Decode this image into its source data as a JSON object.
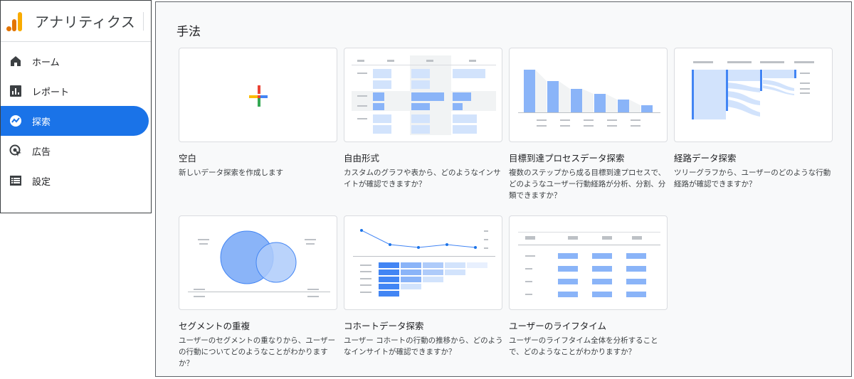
{
  "app": {
    "title": "アナリティクス"
  },
  "sidebar": {
    "items": [
      {
        "label": "ホーム",
        "icon": "home-icon",
        "active": false
      },
      {
        "label": "レポート",
        "icon": "bar-chart-icon",
        "active": false
      },
      {
        "label": "探索",
        "icon": "explore-icon",
        "active": true
      },
      {
        "label": "広告",
        "icon": "ads-cursor-icon",
        "active": false
      },
      {
        "label": "設定",
        "icon": "list-settings-icon",
        "active": false
      }
    ]
  },
  "main": {
    "section_title": "手法",
    "cards": [
      {
        "title": "空白",
        "description": "新しいデータ探索を作成します",
        "thumb": "plus-icon"
      },
      {
        "title": "自由形式",
        "description": "カスタムのグラフや表から、どのようなインサイトが確認できますか？",
        "thumb": "table-thumbnail"
      },
      {
        "title": "目標到達プロセスデータ探索",
        "description": "複数のステップから成る目標到達プロセスで、どのようなユーザー行動経路が分析、分割、分類できますか？",
        "thumb": "funnel-thumbnail"
      },
      {
        "title": "経路データ探索",
        "description": "ツリーグラフから、ユーザーのどのような行動経路が確認できますか？",
        "thumb": "path-thumbnail"
      },
      {
        "title": "セグメントの重複",
        "description": "ユーザーのセグメントの重なりから、ユーザーの行動についてどのようなことがわかりますか？",
        "thumb": "venn-thumbnail"
      },
      {
        "title": "コホートデータ探索",
        "description": "ユーザー コホートの行動の推移から、どのようなインサイトが確認できますか？",
        "thumb": "cohort-thumbnail"
      },
      {
        "title": "ユーザーのライフタイム",
        "description": "ユーザーのライフタイム全体を分析することで、どのようなことがわかりますか？",
        "thumb": "lifetime-thumbnail"
      }
    ]
  },
  "colors": {
    "accent": "#1a73e8",
    "thumb_blue": "#8ab4f8",
    "thumb_light": "#d2e3fc",
    "google_red": "#ea4335",
    "google_blue": "#4285f4",
    "google_green": "#34a853",
    "google_yellow": "#fbbc04"
  }
}
